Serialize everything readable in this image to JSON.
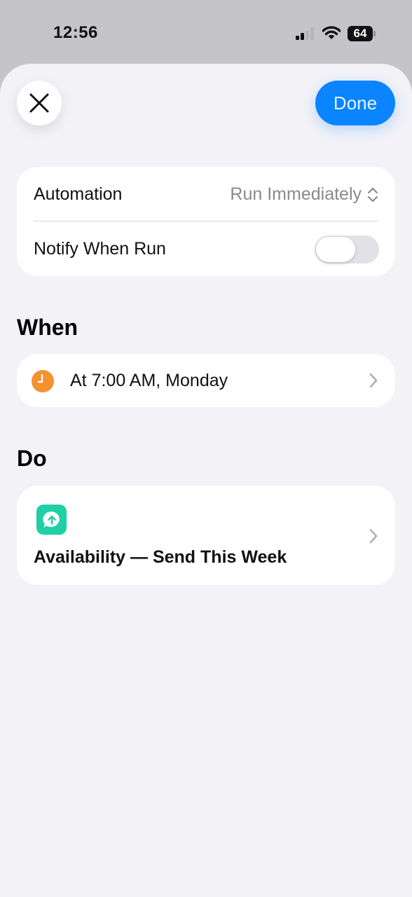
{
  "status_bar": {
    "time": "12:56",
    "battery": "64",
    "signal_icon": "cellular-signal-icon",
    "wifi_icon": "wifi-icon"
  },
  "toolbar": {
    "close_icon": "close-icon",
    "done_label": "Done"
  },
  "settings": {
    "automation_label": "Automation",
    "automation_value": "Run Immediately",
    "notify_label": "Notify When Run",
    "notify_on": false
  },
  "when": {
    "section_title": "When",
    "trigger_text": "At 7:00 AM, Monday",
    "trigger_icon": "clock-icon"
  },
  "do": {
    "section_title": "Do",
    "action_text": "Availability — Send This Week",
    "action_icon": "message-upload-icon"
  },
  "colors": {
    "accent": "#0a84ff",
    "clock": "#f5922f",
    "action_icon_bg": "#1fd0a6",
    "sheet_bg": "#f2f2f7"
  }
}
